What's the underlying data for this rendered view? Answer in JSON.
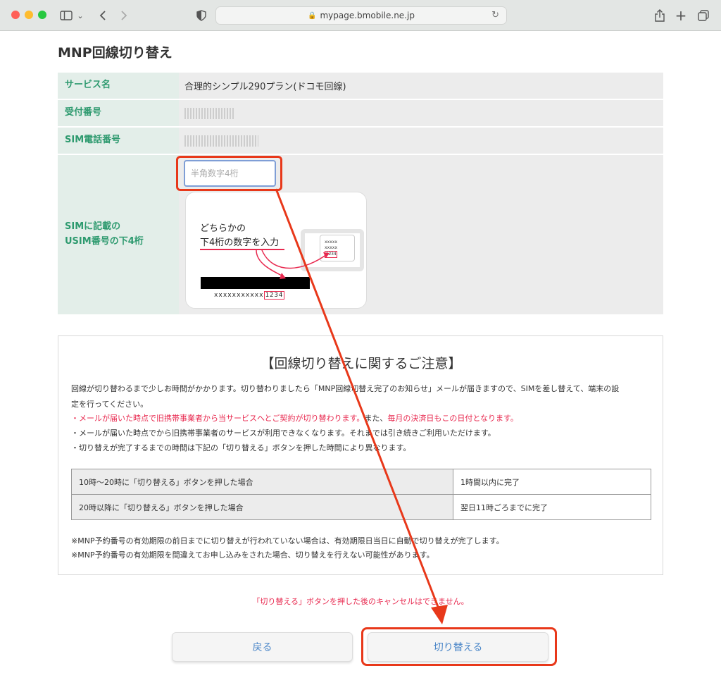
{
  "browser": {
    "url": "mypage.bmobile.ne.jp"
  },
  "page": {
    "title": "MNP回線切り替え"
  },
  "info": {
    "service_label": "サービス名",
    "service_value": "合理的シンプル290プラン(ドコモ回線)",
    "receipt_label": "受付番号",
    "sim_phone_label": "SIM電話番号",
    "usim_label_line1": "SIMに記載の",
    "usim_label_line2": "USIM番号の下4桁",
    "usim_placeholder": "半角数字4桁"
  },
  "sim_illustration": {
    "line1": "どちらかの",
    "line2": "下4桁の数字を入力",
    "card_code_masked": "xxxxxxxxxxx",
    "card_code_last4": "1234",
    "chip_x1": "xxxxx",
    "chip_x2": "xxxxx",
    "chip_last4": "1234"
  },
  "notice": {
    "title": "【回線切り替えに関するご注意】",
    "para1": "回線が切り替わるまで少しお時間がかかります。切り替わりましたら「MNP回線切替え完了のお知らせ」メールが届きますので、SIMを差し替えて、端末の設",
    "para1b": "定を行ってください。",
    "bullet1_red1": "・メールが届いた時点で旧携帯事業者から当サービスへとご契約が切り替わります。",
    "bullet1_mid": "また、",
    "bullet1_red2": "毎月の決済日もこの日付となります。",
    "bullet2": "・メールが届いた時点でから旧携帯事業者のサービスが利用できなくなります。それまでは引き続きご利用いただけます。",
    "bullet3": "・切り替えが完了するまでの時間は下記の「切り替える」ボタンを押した時間により異なります。",
    "rows": [
      {
        "condition": "10時〜20時に「切り替える」ボタンを押した場合",
        "result": "1時間以内に完了"
      },
      {
        "condition": "20時以降に「切り替える」ボタンを押した場合",
        "result": "翌日11時ごろまでに完了"
      }
    ],
    "footnote1": "※MNP予約番号の有効期限の前日までに切り替えが行われていない場合は、有効期限日当日に自動で切り替えが完了します。",
    "footnote2": "※MNP予約番号の有効期限を間違えてお申し込みをされた場合、切り替えを行えない可能性があります。"
  },
  "cancel_warning": "「切り替える」ボタンを押した後のキャンセルはできません。",
  "buttons": {
    "back": "戻る",
    "switch": "切り替える"
  },
  "colors": {
    "accent_green": "#2e9a6f",
    "annotation_red": "#e8381a",
    "warning_red": "#e8294f",
    "button_text": "#4a86c8"
  }
}
